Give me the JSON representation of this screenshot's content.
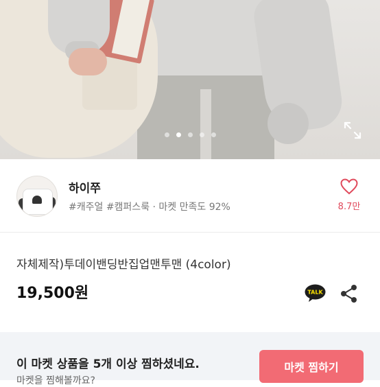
{
  "carousel": {
    "slide_count": 5,
    "active_index": 1
  },
  "seller": {
    "name": "하이쭈",
    "tags": "#캐주얼 #캠퍼스룩 · 마켓 만족도 92%",
    "like_count": "8.7만"
  },
  "product": {
    "title": "자체제작)투데이밴딩반집업맨투맨 (4color)",
    "price": "19,500원"
  },
  "actions": {
    "talk_label": "TALK",
    "share_icon": "share-icon",
    "expand_icon": "expand-icon"
  },
  "banner": {
    "text": "이 마켓 상품을 5개 이상 찜하셨네요.",
    "subtext": "마켓을 찜해볼까요?",
    "button_label": "마켓 찜하기"
  },
  "colors": {
    "accent": "#f26b74",
    "like": "#e0495b",
    "talk_yellow": "#fae100"
  }
}
